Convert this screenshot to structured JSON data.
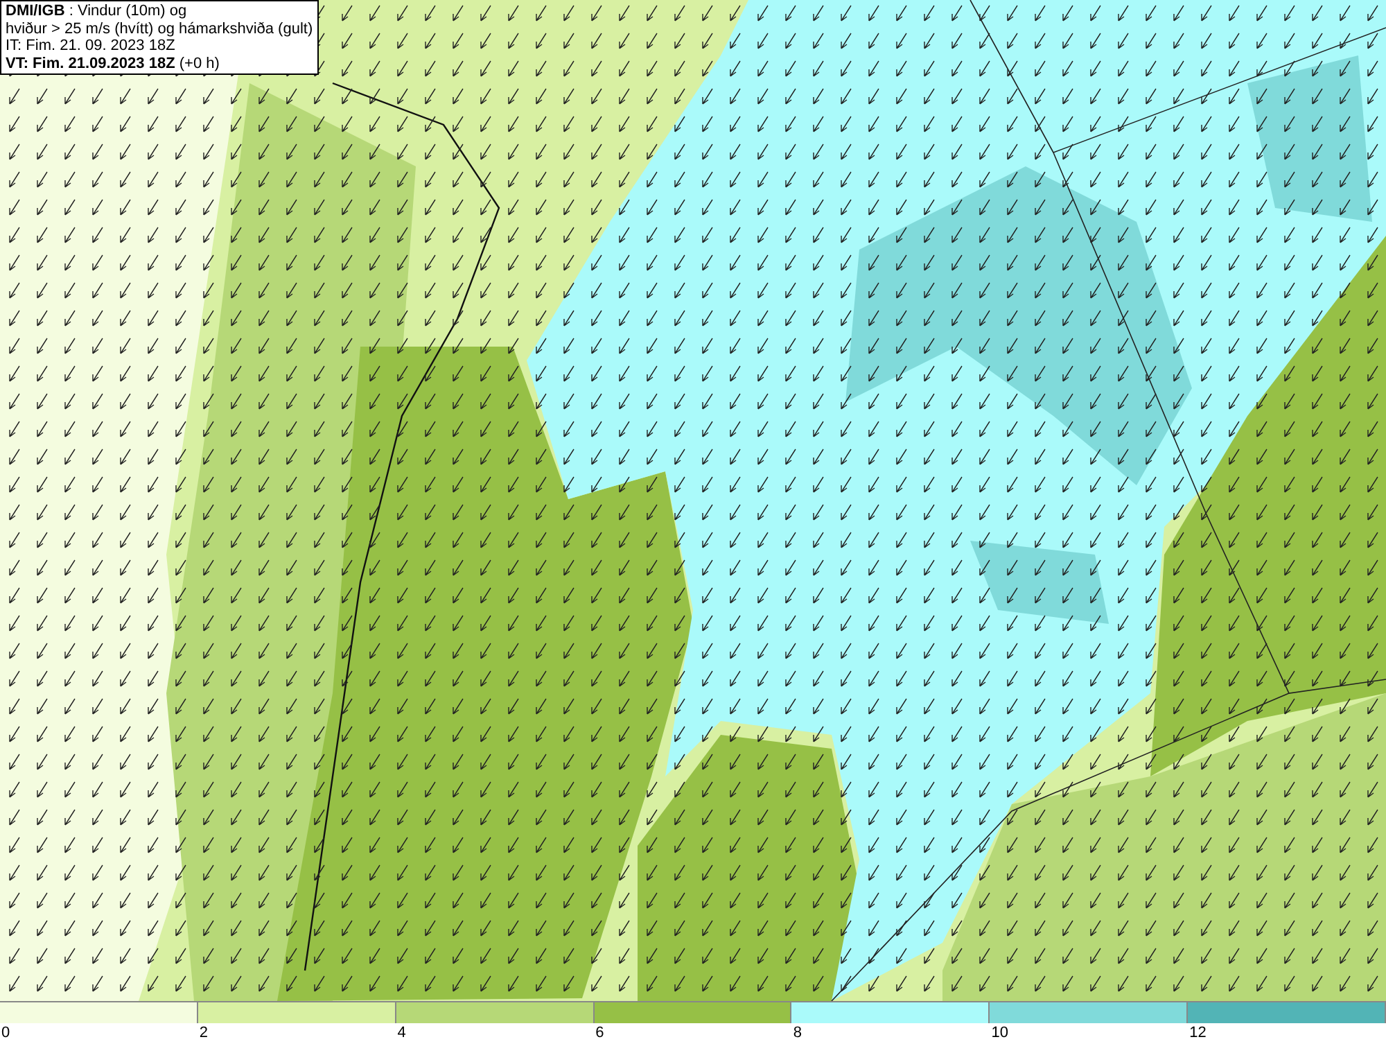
{
  "info_box": {
    "lines": [
      {
        "text": "**DMI/IGB** : Vindur (10m) og"
      },
      {
        "text": "hviður > 25 m/s (hvítt) og hámarkshviða (gult)"
      },
      {
        "text": "IT: Fim. 21. 09. 2023 18Z"
      },
      {
        "text": "**VT: Fim. 21.09.2023 18Z** (+0 h)"
      }
    ]
  },
  "legend": {
    "items": [
      {
        "label": "0",
        "color": "#f4fcdf"
      },
      {
        "label": "2",
        "color": "#d8f0a2"
      },
      {
        "label": "4",
        "color": "#b6d877"
      },
      {
        "label": "6",
        "color": "#96c046"
      },
      {
        "label": "8",
        "color": "#aafafa"
      },
      {
        "label": "10",
        "color": "#80dada"
      },
      {
        "label": "12",
        "color": "#52b4b6"
      }
    ]
  }
}
